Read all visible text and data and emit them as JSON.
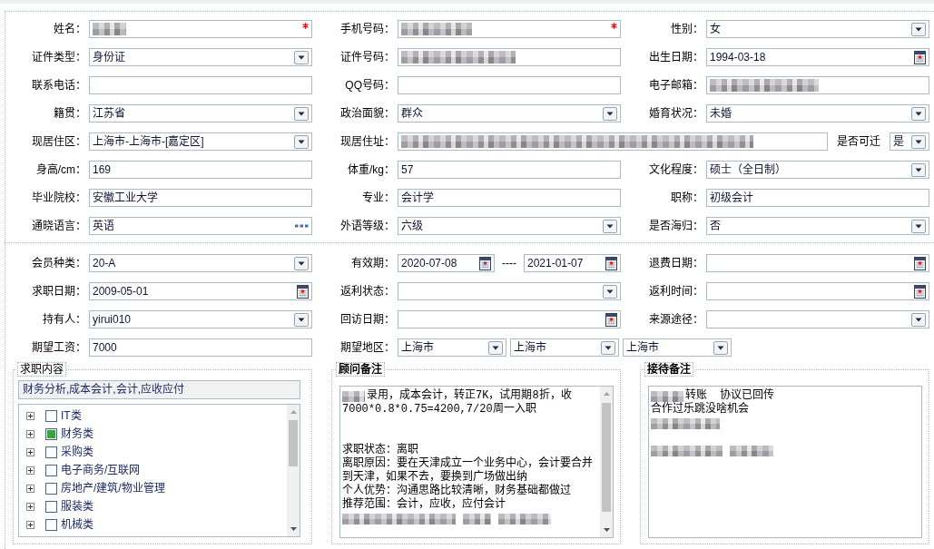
{
  "basic_info": {
    "rows": [
      {
        "groups": [
          {
            "label": "姓名：",
            "controls": [
              {
                "kind": "text",
                "redacted": true,
                "required": true
              }
            ]
          },
          {
            "label": "手机号码：",
            "controls": [
              {
                "kind": "text",
                "redacted": true,
                "required": true
              }
            ]
          },
          {
            "label": "性别：",
            "controls": [
              {
                "kind": "select",
                "value": "女",
                "redacted": false,
                "required": false
              }
            ]
          }
        ]
      },
      {
        "groups": [
          {
            "label": "证件类型：",
            "controls": [
              {
                "kind": "select",
                "value": "身份证",
                "redacted": false,
                "required": false
              }
            ]
          },
          {
            "label": "证件号码：",
            "controls": [
              {
                "kind": "text",
                "redacted": true,
                "required": false
              }
            ]
          },
          {
            "label": "出生日期：",
            "controls": [
              {
                "kind": "date",
                "value": "1994-03-18",
                "redacted": false,
                "required": false
              }
            ]
          }
        ]
      },
      {
        "groups": [
          {
            "label": "联系电话：",
            "controls": [
              {
                "kind": "text",
                "redacted": false,
                "required": false
              }
            ]
          },
          {
            "label": "QQ号码：",
            "controls": [
              {
                "kind": "text",
                "redacted": false,
                "required": false
              }
            ]
          },
          {
            "label": "电子邮箱：",
            "controls": [
              {
                "kind": "text",
                "redacted": true,
                "required": false
              }
            ]
          }
        ]
      },
      {
        "groups": [
          {
            "label": "籍贯：",
            "controls": [
              {
                "kind": "select",
                "value": "江苏省",
                "redacted": false,
                "required": false
              }
            ]
          },
          {
            "label": "政治面貌：",
            "controls": [
              {
                "kind": "select",
                "value": "群众",
                "redacted": false,
                "required": false
              }
            ]
          },
          {
            "label": "婚育状况：",
            "controls": [
              {
                "kind": "select",
                "value": "未婚",
                "redacted": false,
                "required": false
              }
            ]
          }
        ]
      },
      {
        "groups": [
          {
            "label": "现居住区：",
            "controls": [
              {
                "kind": "select",
                "value": "上海市-上海市-[嘉定区]",
                "redacted": false,
                "required": false
              }
            ]
          },
          {
            "label": "现居住址：",
            "controls": [
              {
                "kind": "text",
                "redacted": true,
                "required": false
              },
              {
                "kind": "caption",
                "value": "是否可迁"
              },
              {
                "kind": "select",
                "value": "是",
                "redacted": false,
                "required": false
              }
            ]
          }
        ]
      },
      {
        "groups": [
          {
            "label": "身高/cm：",
            "controls": [
              {
                "kind": "text",
                "value": "169",
                "redacted": false,
                "required": false
              }
            ]
          },
          {
            "label": "体重/kg：",
            "controls": [
              {
                "kind": "text",
                "value": "57",
                "redacted": false,
                "required": false
              }
            ]
          },
          {
            "label": "文化程度：",
            "controls": [
              {
                "kind": "select",
                "value": "硕士（全日制）",
                "redacted": false,
                "required": false
              }
            ]
          }
        ]
      },
      {
        "groups": [
          {
            "label": "毕业院校：",
            "controls": [
              {
                "kind": "text",
                "value": "安徽工业大学",
                "redacted": false,
                "required": false
              }
            ]
          },
          {
            "label": "专业：",
            "controls": [
              {
                "kind": "text",
                "value": "会计学",
                "redacted": false,
                "required": false
              }
            ]
          },
          {
            "label": "职称：",
            "controls": [
              {
                "kind": "text",
                "value": "初级会计",
                "redacted": false,
                "required": false
              }
            ]
          }
        ]
      },
      {
        "groups": [
          {
            "label": "通晓语言：",
            "controls": [
              {
                "kind": "picker",
                "value": "英语",
                "redacted": false,
                "required": false
              }
            ]
          },
          {
            "label": "外语等级：",
            "controls": [
              {
                "kind": "select",
                "value": "六级",
                "redacted": false,
                "required": false
              }
            ]
          },
          {
            "label": "是否海归：",
            "controls": [
              {
                "kind": "select",
                "value": "否",
                "redacted": false,
                "required": false
              }
            ]
          }
        ]
      }
    ]
  },
  "membership": {
    "rows": [
      {
        "groups": [
          {
            "label": "会员种类：",
            "controls": [
              {
                "kind": "select",
                "value": "20-A",
                "redacted": false,
                "required": false
              }
            ]
          },
          {
            "label": "有效期：",
            "controls": [
              {
                "kind": "date",
                "value": "2020-07-08",
                "redacted": false,
                "required": false
              },
              {
                "kind": "caption",
                "value": "----"
              },
              {
                "kind": "date",
                "value": "2021-01-07",
                "redacted": false,
                "required": false
              }
            ]
          },
          {
            "label": "退费日期：",
            "controls": [
              {
                "kind": "date",
                "redacted": false,
                "required": false
              }
            ]
          }
        ]
      },
      {
        "groups": [
          {
            "label": "求职日期：",
            "controls": [
              {
                "kind": "date",
                "value": "2009-05-01",
                "redacted": false,
                "required": false
              }
            ]
          },
          {
            "label": "返利状态：",
            "controls": [
              {
                "kind": "select",
                "redacted": false,
                "required": false
              }
            ]
          },
          {
            "label": "返利时间：",
            "controls": [
              {
                "kind": "date",
                "redacted": false,
                "required": false
              }
            ]
          }
        ]
      },
      {
        "groups": [
          {
            "label": "持有人：",
            "controls": [
              {
                "kind": "select",
                "value": "yirui010",
                "redacted": false,
                "required": false
              }
            ]
          },
          {
            "label": "回访日期：",
            "controls": [
              {
                "kind": "date",
                "redacted": false,
                "required": false
              }
            ]
          },
          {
            "label": "来源途径：",
            "controls": [
              {
                "kind": "select",
                "redacted": false,
                "required": false
              }
            ]
          }
        ]
      },
      {
        "groups": [
          {
            "label": "期望工资：",
            "controls": [
              {
                "kind": "text",
                "value": "7000",
                "redacted": false,
                "required": false
              }
            ]
          },
          {
            "label": "期望地区：",
            "controls": [
              {
                "kind": "select",
                "value": "上海市",
                "redacted": false,
                "required": false
              },
              {
                "kind": "select",
                "value": "上海市",
                "redacted": false,
                "required": false
              },
              {
                "kind": "select",
                "value": "上海市",
                "redacted": false,
                "required": false
              }
            ]
          }
        ]
      }
    ]
  },
  "job_intent": {
    "legend": "求职内容",
    "summary": "财务分析,成本会计,会计,应收应付",
    "categories": [
      {
        "label": "IT类",
        "expanded": false,
        "checked": false
      },
      {
        "label": "财务类",
        "expanded": false,
        "checked": true
      },
      {
        "label": "采购类",
        "expanded": false,
        "checked": false
      },
      {
        "label": "电子商务/互联网",
        "expanded": false,
        "checked": false
      },
      {
        "label": "房地产/建筑/物业管理",
        "expanded": false,
        "checked": false
      },
      {
        "label": "服装类",
        "expanded": false,
        "checked": false
      },
      {
        "label": "机械类",
        "expanded": false,
        "checked": false
      }
    ]
  },
  "advisor_notes": {
    "legend": "顾问备注",
    "paragraphs": [
      {
        "lines": [
          {
            "parts": [
              {
                "kind": "blur"
              },
              {
                "kind": "text",
                "text": "录用，成本会计，转正7K，试用期8折，收"
              }
            ]
          },
          {
            "parts": [
              {
                "kind": "text",
                "text": "7000*0.8*0.75=4200,7/20周一入职"
              }
            ]
          }
        ]
      },
      {
        "lines": [
          {
            "parts": [
              {
                "kind": "text",
                "text": "求职状态：离职"
              }
            ]
          },
          {
            "parts": [
              {
                "kind": "text",
                "text": "离职原因：要在天津成立一个业务中心，会计要合并"
              }
            ]
          },
          {
            "parts": [
              {
                "kind": "text",
                "text": "到天津，如果不去，要换到广场做出纳"
              }
            ]
          },
          {
            "parts": [
              {
                "kind": "text",
                "text": "个人优势：沟通思路比较清晰，财务基础都做过"
              }
            ]
          },
          {
            "parts": [
              {
                "kind": "text",
                "text": "推荐范围：会计，应收，应付会计"
              }
            ]
          },
          {
            "parts": [
              {
                "kind": "blur"
              },
              {
                "kind": "blur"
              },
              {
                "kind": "blur"
              }
            ]
          }
        ]
      }
    ]
  },
  "reception_notes": {
    "legend": "接待备注",
    "paragraphs": [
      {
        "lines": [
          {
            "parts": [
              {
                "kind": "blur"
              },
              {
                "kind": "text",
                "text": "转账  协议已回传"
              }
            ]
          },
          {
            "parts": [
              {
                "kind": "text",
                "text": "合作过乐跳没啥机会"
              }
            ]
          },
          {
            "parts": [
              {
                "kind": "blur"
              }
            ]
          }
        ]
      },
      {
        "lines": [
          {
            "parts": [
              {
                "kind": "blur"
              },
              {
                "kind": "blur"
              }
            ]
          }
        ]
      }
    ]
  }
}
